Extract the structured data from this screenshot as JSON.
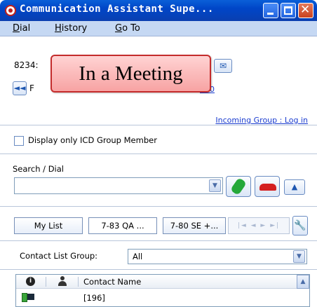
{
  "window": {
    "title": "Communication Assistant Supe...",
    "icon": "app-logo-icon",
    "controls": [
      "minimize-icon",
      "maximize-icon",
      "close-icon"
    ]
  },
  "menu": {
    "dial": "ial",
    "dial_mnemonic": "D",
    "history": "istory",
    "history_mnemonic": "H",
    "goto": "o To",
    "goto_mnemonic": "G"
  },
  "info": {
    "extension_partial": "8234:",
    "forward_partial": "F",
    "link_partial": "500",
    "incoming_group_link": "Incoming Group : Log in"
  },
  "status_overlay": "In a Meeting",
  "display_only_checkbox": {
    "label": "Display only ICD Group Member",
    "checked": false
  },
  "search": {
    "label": "Search / Dial",
    "value": ""
  },
  "tabs": [
    "My List",
    "7-83 QA ...",
    "7-80 SE +..."
  ],
  "tab_nav": "|◄ ◄ ► ►|",
  "contact_group": {
    "label": "Contact List Group:",
    "selected": "All"
  },
  "table": {
    "headers": {
      "name": "Contact Name"
    },
    "rows": [
      {
        "name": "[196]"
      }
    ]
  },
  "colors": {
    "title_bar": "#0046c8",
    "menu_bar": "#c5d8f3",
    "overlay_bg": "#f7a3a3",
    "overlay_border": "#c42c2c",
    "link": "#1a3ccf"
  }
}
